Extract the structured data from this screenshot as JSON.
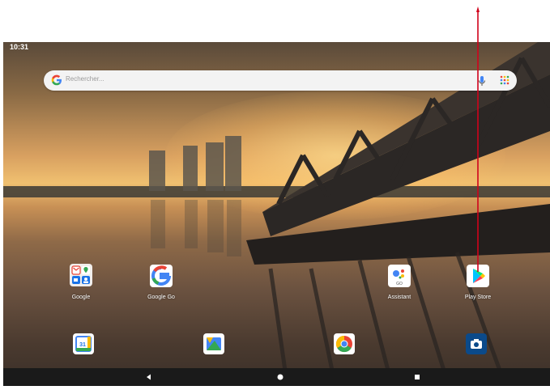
{
  "status_bar": {
    "time": "10:31"
  },
  "search": {
    "placeholder": "Rechercher..."
  },
  "home_apps": [
    {
      "label": "Google"
    },
    {
      "label": "Google Go"
    },
    {
      "label": "Assistant"
    },
    {
      "label": "Play Store"
    }
  ],
  "dock": [
    "calendar-icon",
    "files-icon",
    "chrome-icon",
    "camera-icon"
  ],
  "colors": {
    "annotation_arrow": "#d0021b",
    "nav_bar": "#1a1a1a"
  }
}
